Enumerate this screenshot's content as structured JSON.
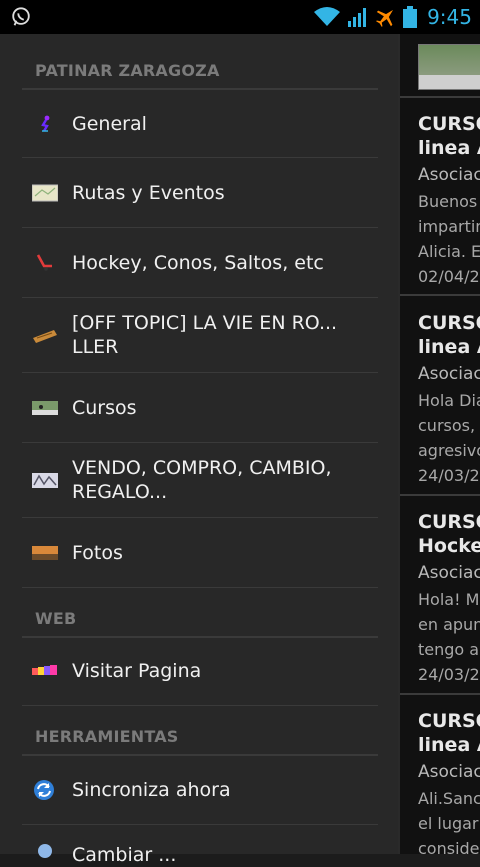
{
  "status_bar": {
    "time": "9:45",
    "icons": [
      "whatsapp-icon",
      "wifi-icon",
      "signal-icon",
      "airplane-icon",
      "battery-icon"
    ]
  },
  "drawer": {
    "sections": [
      {
        "title": "PATINAR ZARAGOZA"
      },
      {
        "title": "WEB"
      },
      {
        "title": "HERRAMIENTAS"
      }
    ],
    "items": [
      {
        "label": "General",
        "icon": "skater-icon"
      },
      {
        "label": "Rutas y Eventos",
        "icon": "map-icon"
      },
      {
        "label": "Hockey, Conos, Saltos, etc",
        "icon": "hockey-stick-icon"
      },
      {
        "label": "[OFF TOPIC] LA VIE EN RO... LLER",
        "icon": "tag-icon"
      },
      {
        "label": "Cursos",
        "icon": "courses-photo-icon"
      },
      {
        "label": "VENDO, COMPRO, CAMBIO, REGALO...",
        "icon": "trade-icon"
      },
      {
        "label": "Fotos",
        "icon": "photos-icon"
      },
      {
        "label": "Visitar Pagina",
        "icon": "website-icon"
      },
      {
        "label": "Sincroniza ahora",
        "icon": "sync-icon"
      },
      {
        "label": "Cambiar ...",
        "icon": "user-icon"
      }
    ]
  },
  "content": {
    "posts": [
      {
        "title_1": "CURSO",
        "title_2": "linea A",
        "author": "Asociac",
        "snippet_1": "Buenos",
        "snippet_2": "impartin",
        "snippet_3": "Alicia. E",
        "date": "02/04/2"
      },
      {
        "title_1": "CURSO",
        "title_2": "linea A",
        "author": "Asociac",
        "snippet_1": "Hola Dia",
        "snippet_2": "cursos,",
        "snippet_3": "agresivo",
        "date": "24/03/2"
      },
      {
        "title_1": "CURSO",
        "title_2": "Hockey",
        "author": "Asociac",
        "snippet_1": "Hola! M",
        "snippet_2": "en apun",
        "snippet_3": "tengo a",
        "date": "24/03/2"
      },
      {
        "title_1": "CURSO",
        "title_2": "linea A",
        "author": "Asociac",
        "snippet_1": "Ali.Sanc",
        "snippet_2": "el lugar",
        "snippet_3": "conside",
        "date": ""
      }
    ]
  },
  "colors": {
    "accent": "#33b5e5",
    "drawer_bg": "#282828",
    "divider": "#3a3a3a"
  }
}
